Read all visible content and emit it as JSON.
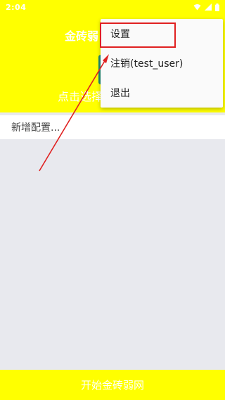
{
  "status_bar": {
    "time": "2:04",
    "icons": [
      "wifi-icon",
      "signal-icon",
      "battery-icon"
    ]
  },
  "header": {
    "title": "金砖弱",
    "hint": "点击选择"
  },
  "config_row": {
    "label": "新增配置..."
  },
  "menu": {
    "items": [
      {
        "label": "设置"
      },
      {
        "label": "注销(test_user)"
      },
      {
        "label": "退出"
      }
    ]
  },
  "footer": {
    "start_label": "开始金砖弱网"
  },
  "colors": {
    "accent_yellow": "#ffff00",
    "annotation_red": "#e02020",
    "chip_green": "#1d8c74",
    "background": "#e8e9ee"
  }
}
